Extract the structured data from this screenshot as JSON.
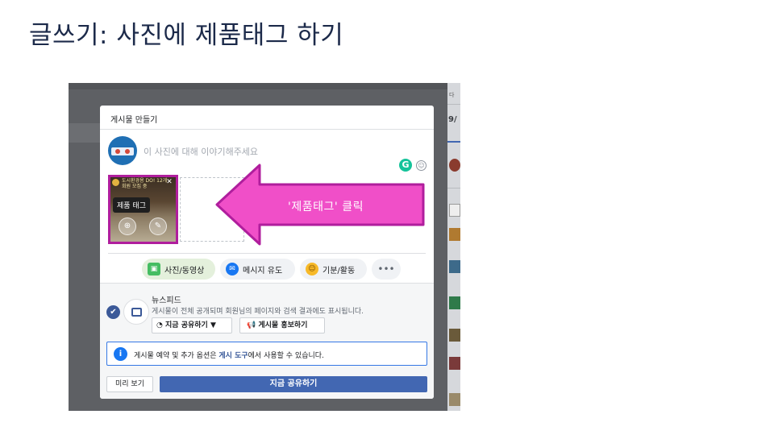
{
  "slide": {
    "title": "글쓰기: 사진에 제품태그 하기"
  },
  "modal": {
    "header_label": "게시물 만들기",
    "composer_placeholder": "이 사진에 대해 이야기해주세요",
    "photo": {
      "caption": "도시환경용 DO! 12개 회원 모집 중",
      "tag_tooltip": "제품 태그",
      "close_glyph": "✕"
    },
    "callout_text": "'제품태그' 클릭",
    "chips": {
      "photo_video": "사진/동영상",
      "message": "메시지 유도",
      "feeling": "기분/활동",
      "more": "•••"
    },
    "newsfeed": {
      "title": "뉴스피드",
      "description": "게시물이 전체 공개되며 회원님의 페이지와 검색 결과에도 표시됩니다.",
      "share_dropdown": "지금 공유하기 ▼",
      "promote_button": "게시물 홍보하기"
    },
    "info": {
      "text_before": "게시물 예약 및 추가 옵션은 ",
      "link": "게시 도구",
      "text_after": "에서 사용할 수 있습니다."
    },
    "footer": {
      "preview_button": "미리 보기",
      "share_now_button": "지금 공유하기"
    }
  },
  "right_panel": {
    "text_top": "9/",
    "text_small": "다"
  },
  "colors": {
    "highlight": "#b01e9d",
    "callout_fill": "#f04fc8",
    "facebook_blue": "#4267b2"
  }
}
